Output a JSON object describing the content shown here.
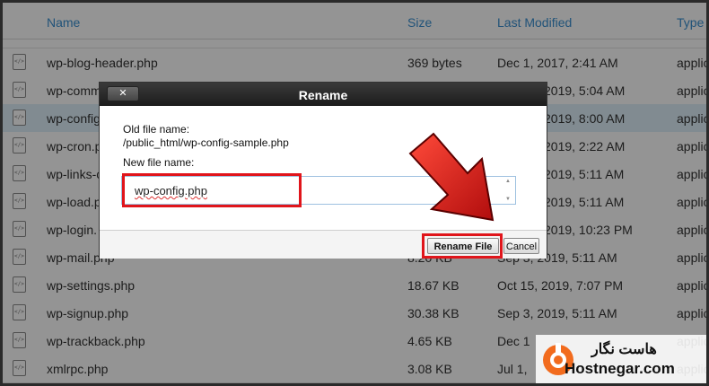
{
  "table": {
    "headers": [
      "Name",
      "Size",
      "Last Modified",
      "Type"
    ],
    "rows": [
      {
        "name": "wp-blog-header.php",
        "size": "369 bytes",
        "modified": "Dec 1, 2017, 2:41 AM",
        "type": "applic"
      },
      {
        "name": "wp-comm",
        "size": "",
        "modified": "2019, 5:04 AM",
        "type": "applic"
      },
      {
        "name": "wp-config",
        "size": "",
        "modified": "2019, 8:00 AM",
        "type": "applic"
      },
      {
        "name": "wp-cron.p",
        "size": "",
        "modified": "2019, 2:22 AM",
        "type": "applic"
      },
      {
        "name": "wp-links-c",
        "size": "",
        "modified": "2019, 5:11 AM",
        "type": "applic"
      },
      {
        "name": "wp-load.p",
        "size": "",
        "modified": "2019, 5:11 AM",
        "type": "applic"
      },
      {
        "name": "wp-login.",
        "size": "",
        "modified": "2019, 10:23 PM",
        "type": "applic"
      },
      {
        "name": "wp-mail.php",
        "size": "8.20 KB",
        "modified": "Sep 3, 2019, 5:11 AM",
        "type": "applic"
      },
      {
        "name": "wp-settings.php",
        "size": "18.67 KB",
        "modified": "Oct 15, 2019, 7:07 PM",
        "type": "applic"
      },
      {
        "name": "wp-signup.php",
        "size": "30.38 KB",
        "modified": "Sep 3, 2019, 5:11 AM",
        "type": "applic"
      },
      {
        "name": "wp-trackback.php",
        "size": "4.65 KB",
        "modified": "Dec 1",
        "type": "applic"
      },
      {
        "name": "xmlrpc.php",
        "size": "3.08 KB",
        "modified": "Jul 1,",
        "type": "applic"
      }
    ]
  },
  "dialog": {
    "title": "Rename",
    "close_label": "✕",
    "old_label": "Old file name:",
    "old_value": "/public_html/wp-config-sample.php",
    "new_label": "New file name:",
    "new_value": "wp-config.php",
    "rename_button": "Rename File",
    "cancel_button": "Cancel"
  },
  "watermark": {
    "brand_fa": "هاست نگار",
    "brand_en": "Hostnegar.com"
  },
  "colors": {
    "header_text": "#3a8fd0",
    "highlight": "#e0151b",
    "logo_orange": "#f26b1d"
  }
}
